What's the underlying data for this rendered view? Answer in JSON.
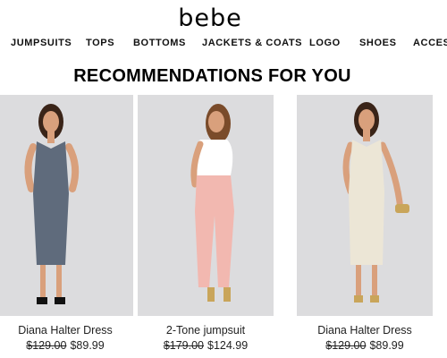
{
  "brand": {
    "logo_text": "bebe"
  },
  "nav": {
    "items": [
      {
        "label": "JUMPSUITS"
      },
      {
        "label": "TOPS"
      },
      {
        "label": "BOTTOMS"
      },
      {
        "label": "JACKETS & COATS"
      },
      {
        "label": "LOGO"
      },
      {
        "label": "SHOES"
      },
      {
        "label": "ACCESS"
      }
    ]
  },
  "recommendations": {
    "title": "RECOMMENDATIONS FOR YOU",
    "products": [
      {
        "name": "Diana Halter Dress",
        "original_price": "$129.00",
        "sale_price": "$89.99",
        "garment_color": "#5f6b7c"
      },
      {
        "name": "2-Tone jumpsuit",
        "original_price": "$179.00",
        "sale_price": "$124.99",
        "garment_color": "#f2b8b0"
      },
      {
        "name": "Diana Halter Dress",
        "original_price": "$129.00",
        "sale_price": "$89.99",
        "garment_color": "#ece6d6"
      }
    ]
  },
  "colors": {
    "photo_background": "#dcdcde",
    "skin": "#d9a07c",
    "hair": "#3a2418"
  }
}
